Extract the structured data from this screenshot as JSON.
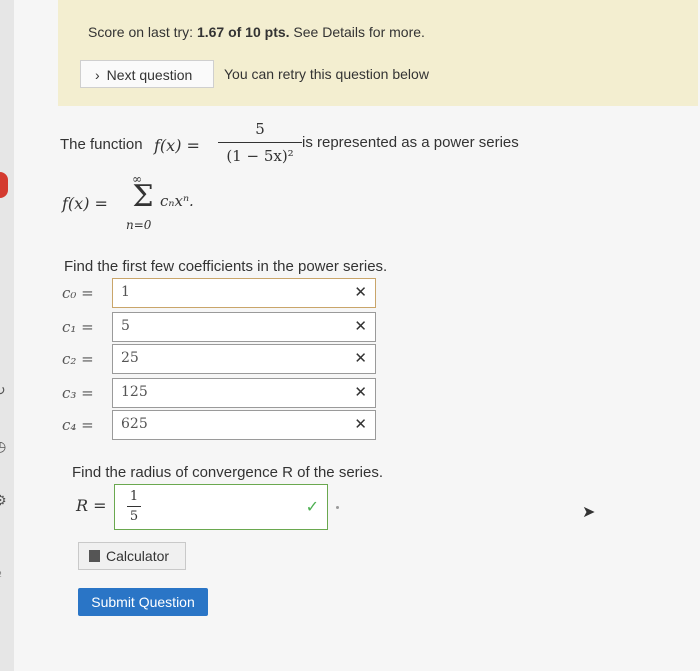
{
  "banner": {
    "score_prefix": "Score on last try: ",
    "score_value": "1.67 of 10 pts.",
    "score_suffix": " See Details for more.",
    "next_question_label": "Next question",
    "retry_text": "You can retry this question below"
  },
  "question": {
    "intro": "The function",
    "fx": "f(x) =",
    "numerator": "5",
    "denominator": "(1 − 5x)²",
    "represented": "is represented as a power series",
    "sum_lhs": "f(x) =",
    "sum_upper": "∞",
    "sum_lower": "n=0",
    "sum_term": "cₙxⁿ.",
    "find_coefficients": "Find the first few coefficients in the power series.",
    "coefficients": [
      {
        "label": "c₀ =",
        "value": "1"
      },
      {
        "label": "c₁ =",
        "value": "5"
      },
      {
        "label": "c₂ =",
        "value": "25"
      },
      {
        "label": "c₃ =",
        "value": "125"
      },
      {
        "label": "c₄ =",
        "value": "625"
      }
    ],
    "find_radius": "Find the radius of convergence R of the series.",
    "radius_label": "R =",
    "radius_num": "1",
    "radius_den": "5"
  },
  "buttons": {
    "calculator": "Calculator",
    "submit": "Submit Question"
  },
  "colors": {
    "banner_bg": "#f3eed0",
    "submit_bg": "#2a75c6",
    "correct_border": "#6aa84f",
    "correct_check": "#4caf50"
  }
}
